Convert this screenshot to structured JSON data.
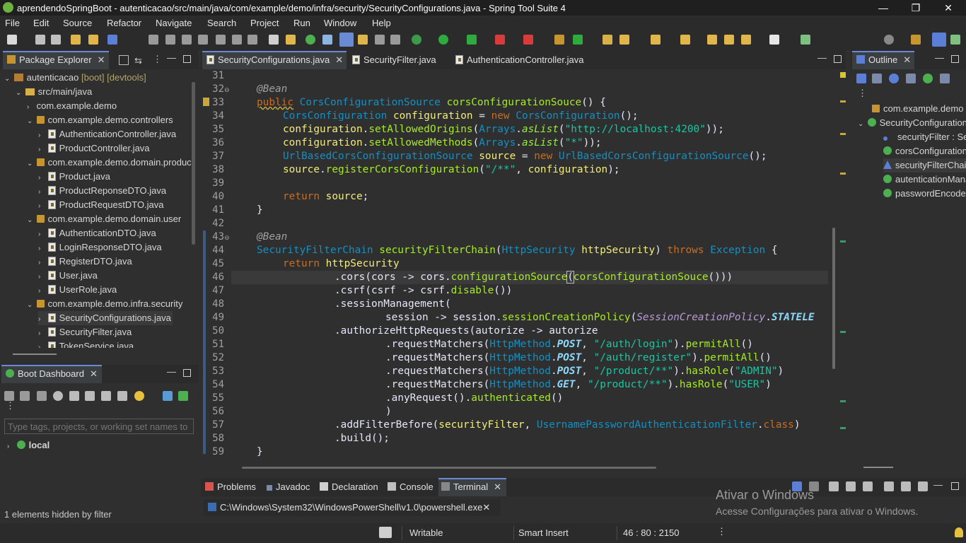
{
  "window": {
    "title": "aprendendoSpringBoot - autenticacao/src/main/java/com/example/demo/infra/security/SecurityConfigurations.java - Spring Tool Suite 4",
    "minimize": "—",
    "maximize": "❐",
    "close": "✕"
  },
  "menu": [
    "File",
    "Edit",
    "Source",
    "Refactor",
    "Navigate",
    "Search",
    "Project",
    "Run",
    "Window",
    "Help"
  ],
  "package_explorer": {
    "tab_label": "Package Explorer",
    "tree": [
      {
        "text": "autenticacao",
        "deco": "[boot] [devtools]"
      },
      {
        "text": "src/main/java"
      },
      {
        "text": "com.example.demo"
      },
      {
        "text": "com.example.demo.controllers"
      },
      {
        "text": "AuthenticationController.java"
      },
      {
        "text": "ProductController.java"
      },
      {
        "text": "com.example.demo.domain.product"
      },
      {
        "text": "Product.java"
      },
      {
        "text": "ProductReponseDTO.java"
      },
      {
        "text": "ProductRequestDTO.java"
      },
      {
        "text": "com.example.demo.domain.user"
      },
      {
        "text": "AuthenticationDTO.java"
      },
      {
        "text": "LoginResponseDTO.java"
      },
      {
        "text": "RegisterDTO.java"
      },
      {
        "text": "User.java"
      },
      {
        "text": "UserRole.java"
      },
      {
        "text": "com.example.demo.infra.security"
      },
      {
        "text": "SecurityConfigurations.java"
      },
      {
        "text": "SecurityFilter.java"
      },
      {
        "text": "TokenService.java"
      }
    ]
  },
  "boot_dashboard": {
    "tab_label": "Boot Dashboard",
    "filter_placeholder": "Type tags, projects, or working set names to",
    "local_label": "local",
    "hidden_note": "1 elements hidden by filter"
  },
  "editor": {
    "tabs": [
      {
        "label": "SecurityConfigurations.java",
        "active": true
      },
      {
        "label": "SecurityFilter.java"
      },
      {
        "label": "AuthenticationController.java"
      }
    ],
    "line_numbers": [
      "31",
      "32",
      "33",
      "34",
      "35",
      "36",
      "37",
      "38",
      "39",
      "40",
      "41",
      "42",
      "43",
      "44",
      "45",
      "46",
      "47",
      "48",
      "49",
      "50",
      "51",
      "52",
      "53",
      "54",
      "55",
      "56",
      "57",
      "58",
      "59"
    ],
    "tokens": {
      "bean": "@Bean",
      "public": "public",
      "cors_source_type": "CorsConfigurationSource",
      "cors_method": "corsConfigurationSouce",
      "cors_config_type": "CorsConfiguration",
      "configuration": "configuration",
      "new": "new",
      "set_origins": "setAllowedOrigins",
      "arrays": "Arrays",
      "aslist": "asList",
      "origin_str": "\"http://localhost:4200\"",
      "set_methods": "setAllowedMethods",
      "star_str": "\"*\"",
      "url_source_type": "UrlBasedCorsConfigurationSource",
      "source": "source",
      "register_cors": "registerCorsConfiguration",
      "path_all": "\"/**\"",
      "return": "return",
      "sfc_type": "SecurityFilterChain",
      "sfc_method": "securityFilterChain",
      "http_security_type": "HttpSecurity",
      "http_security": "httpSecurity",
      "throws": "throws",
      "exception": "Exception",
      "cors_call": ".cors(cors -> cors.",
      "configuration_source": "configurationSource",
      "csrf_call": ".csrf(csrf -> csrf.",
      "disable": "disable",
      "session_mgmt": ".sessionManagement(",
      "session_lambda": "session -> session.",
      "session_policy_m": "sessionCreationPolicy",
      "scp_type": "SessionCreationPolicy",
      "stateless": "STATELE",
      "authorize_http": ".authorizeHttpRequests(autorize -> autorize",
      "request_matchers": ".requestMatchers(",
      "http_method": "HttpMethod",
      "post": "POST",
      "get": "GET",
      "auth_login": "\"/auth/login\"",
      "auth_register": "\"/auth/register\"",
      "product_path": "\"/product/**\"",
      "permit_all": "permitAll",
      "has_role": "hasRole",
      "admin": "\"ADMIN\"",
      "user": "\"USER\"",
      "any_request": ".anyRequest().",
      "authenticated": "authenticated",
      "add_filter_before": ".addFilterBefore(",
      "security_filter": "securityFilter",
      "upaf": "UsernamePasswordAuthenticationFilter",
      "class_kw": "class",
      "build": ".build();"
    }
  },
  "outline": {
    "tab_label": "Outline",
    "items": [
      "com.example.demo",
      "SecurityConfigurations",
      "securityFilter : SecurityFilter",
      "corsConfigurationSouce() : CorsConfigurationSource",
      "securityFilterChain(HttpSecurity) : SecurityFilterChain",
      "autenticationManager(AuthenticationConfiguration) : AuthenticationManager",
      "passwordEncoder() : PasswordEncoder"
    ]
  },
  "bottom_panel": {
    "tabs": [
      "Problems",
      "Javadoc",
      "Declaration",
      "Console",
      "Terminal"
    ],
    "terminal_path": "C:\\Windows\\System32\\WindowsPowerShell\\v1.0\\powershell.exe"
  },
  "watermark": {
    "title": "Ativar o Windows",
    "subtitle": "Acesse Configurações para ativar o Windows."
  },
  "status": {
    "writable": "Writable",
    "insert_mode": "Smart Insert",
    "position": "46 : 80 : 2150"
  },
  "colors": {
    "keyword": "#cc6c1d",
    "type": "#1290c3",
    "method": "#a7ec21",
    "variable": "#f3ec79",
    "string": "#17c6a3",
    "annotation": "#a0a0a0"
  }
}
